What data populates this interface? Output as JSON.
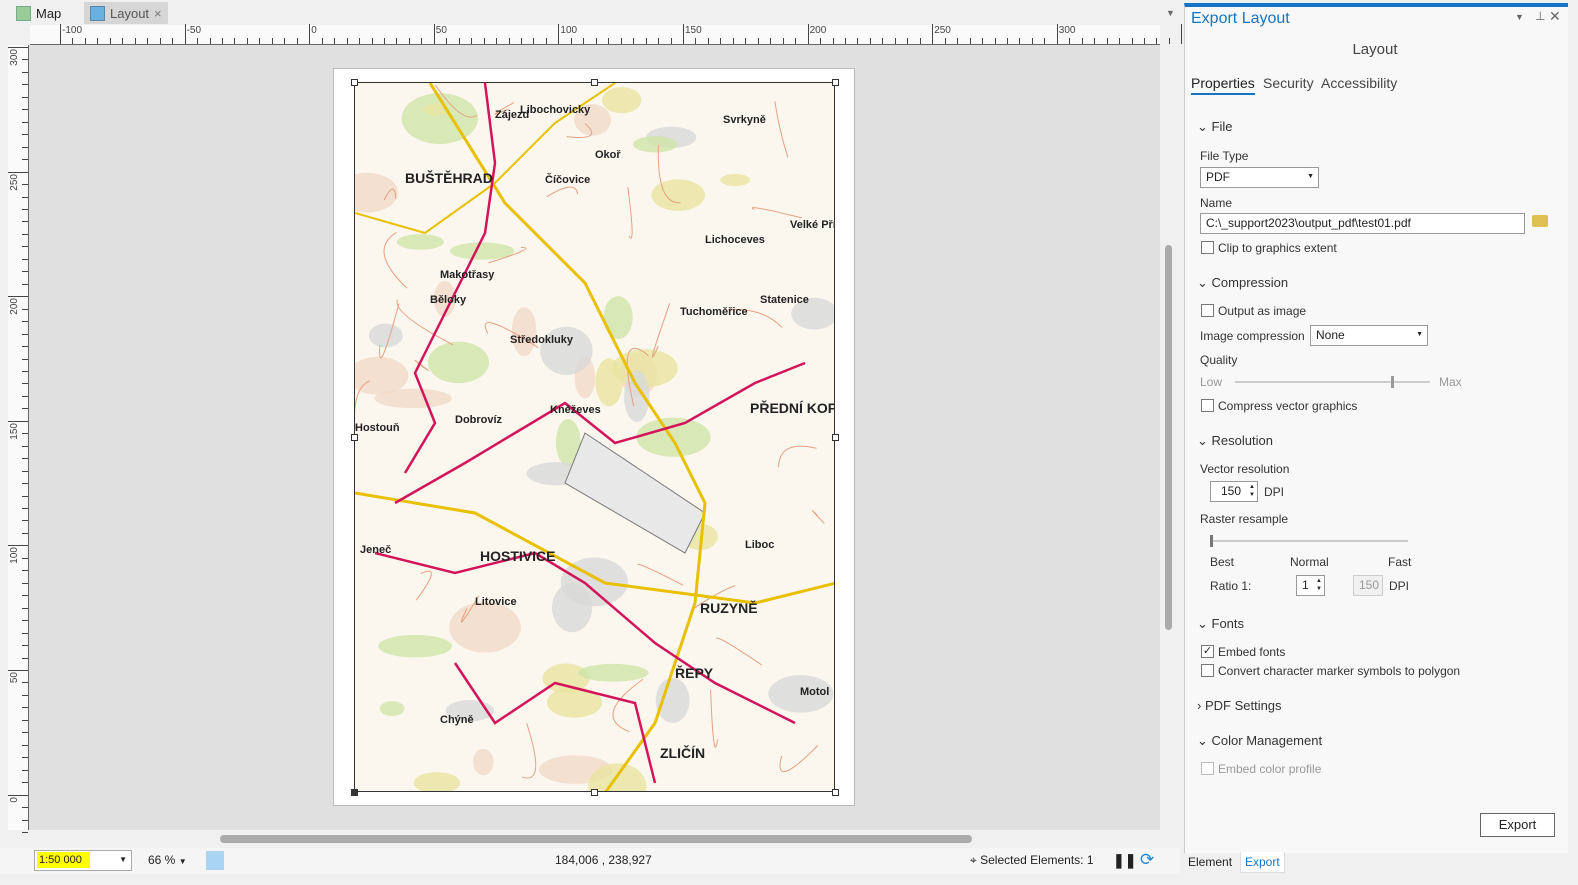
{
  "tabs": [
    {
      "label": "Map"
    },
    {
      "label": "Layout",
      "close": "×"
    }
  ],
  "ruler": {
    "h_labels": [
      "-100",
      "-50",
      "0",
      "50",
      "100",
      "150",
      "200",
      "250",
      "300"
    ],
    "v_labels": [
      "300",
      "250",
      "200",
      "150",
      "100",
      "50",
      "0"
    ]
  },
  "map": {
    "labels": [
      "BUŠTĚHRAD",
      "Číčovice",
      "Makotřasy",
      "Středokluky",
      "Kněževes",
      "Dobrovíz",
      "HOSTIVICE",
      "Jeneč",
      "Chýně",
      "Tuchoměřice",
      "Statenice",
      "Lichoceves",
      "Velké Přílepy",
      "RUZYNĚ",
      "ŘEPY",
      "ZLIČÍN",
      "PŘEDNÍ KOPANINA",
      "Libochovicky",
      "Zájezd",
      "Svrkyně",
      "Okoř",
      "Běloky",
      "Litovice",
      "Hostouň",
      "Liboc",
      "Motol"
    ]
  },
  "status": {
    "scale": "1:50 000",
    "zoom": "66 %",
    "coords": "184,006 , 238,927",
    "selected": "Selected Elements: 1"
  },
  "panel": {
    "title": "Export Layout",
    "subtitle": "Layout",
    "tabs": [
      "Properties",
      "Security",
      "Accessibility"
    ],
    "file": {
      "header": "File",
      "file_type_label": "File Type",
      "file_type": "PDF",
      "name_label": "Name",
      "name_value": "C:\\_support2023\\output_pdf\\test01.pdf",
      "clip": "Clip to graphics extent"
    },
    "compression": {
      "header": "Compression",
      "output_as_image": "Output as image",
      "image_compression_label": "Image compression",
      "image_compression": "None",
      "quality_label": "Quality",
      "low": "Low",
      "max": "Max",
      "compress_vector": "Compress vector graphics",
      "quality_level": 0.8
    },
    "resolution": {
      "header": "Resolution",
      "vector_label": "Vector resolution",
      "vector_value": "150",
      "dpi": "DPI",
      "raster_label": "Raster resample",
      "best": "Best",
      "normal": "Normal",
      "fast": "Fast",
      "ratio_label": "Ratio 1:",
      "ratio_value": "1",
      "ratio_dpi": "150"
    },
    "fonts": {
      "header": "Fonts",
      "embed": "Embed fonts",
      "embed_checked": true,
      "convert": "Convert character marker symbols to polygon"
    },
    "pdf_settings": {
      "header": "PDF Settings"
    },
    "color": {
      "header": "Color Management",
      "embed_profile": "Embed color profile"
    },
    "export_button": "Export",
    "bottom_tabs": [
      "Element",
      "Export"
    ]
  },
  "colors": {
    "accent": "#1474c6",
    "highlight": "#ffff00",
    "boundary": "#d4145a",
    "road": "#e8c000"
  }
}
